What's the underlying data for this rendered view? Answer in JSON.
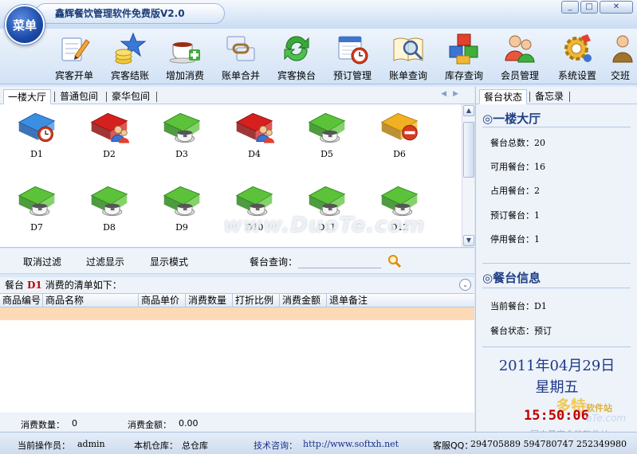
{
  "window": {
    "menu_label": "菜单",
    "title": "鑫辉餐饮管理软件免费版V2.0",
    "minimize": "_",
    "maximize": "□",
    "close": "✕"
  },
  "toolbar": {
    "items": [
      {
        "label": "宾客开单",
        "icon": "pencil-note-icon"
      },
      {
        "label": "宾客结账",
        "icon": "coins-star-icon"
      },
      {
        "label": "增加消费",
        "icon": "teacup-plus-icon"
      },
      {
        "label": "账单合并",
        "icon": "chain-link-icon"
      },
      {
        "label": "宾客换台",
        "icon": "green-swap-icon"
      },
      {
        "label": "预订管理",
        "icon": "calendar-clock-icon"
      },
      {
        "label": "账单查询",
        "icon": "magnifier-book-icon"
      },
      {
        "label": "库存查询",
        "icon": "cubes-icon"
      },
      {
        "label": "会员管理",
        "icon": "members-icon"
      },
      {
        "label": "系统设置",
        "icon": "gear-icon"
      },
      {
        "label": "交班",
        "icon": "handover-icon"
      }
    ]
  },
  "area_tabs": {
    "items": [
      "一楼大厅",
      "普通包间",
      "豪华包间"
    ],
    "active": "一楼大厅"
  },
  "tables": [
    {
      "id": "D1",
      "state": "reserved"
    },
    {
      "id": "D2",
      "state": "occupied"
    },
    {
      "id": "D3",
      "state": "available"
    },
    {
      "id": "D4",
      "state": "occupied"
    },
    {
      "id": "D5",
      "state": "available"
    },
    {
      "id": "D6",
      "state": "disabled"
    },
    {
      "id": "D7",
      "state": "available"
    },
    {
      "id": "D8",
      "state": "available"
    },
    {
      "id": "D9",
      "state": "available"
    },
    {
      "id": "D10",
      "state": "available"
    },
    {
      "id": "D11",
      "state": "available"
    },
    {
      "id": "D12",
      "state": "available"
    }
  ],
  "filter": {
    "cancel_filter": "取消过滤",
    "filter_display": "过滤显示",
    "display_mode": "显示模式",
    "search_label": "餐台查询：",
    "search_value": ""
  },
  "orders": {
    "prefix": "餐台",
    "table_no": "D1",
    "suffix": "消费的清单如下：",
    "columns": [
      "商品编号",
      "商品名称",
      "商品单价",
      "消费数量",
      "打折比例",
      "消费金额",
      "退单备注"
    ]
  },
  "totals": {
    "qty_label": "消费数量：",
    "qty_value": "0",
    "amount_label": "消费金额：",
    "amount_value": "0.00"
  },
  "right_panel": {
    "tabs": [
      "餐台状态",
      "备忘录"
    ],
    "hall_title": "◎一楼大厅",
    "stats": [
      {
        "label": "餐台总数：",
        "value": "20"
      },
      {
        "label": "可用餐台：",
        "value": "16"
      },
      {
        "label": "占用餐台：",
        "value": "2"
      },
      {
        "label": "预订餐台：",
        "value": "1"
      },
      {
        "label": "停用餐台：",
        "value": "1"
      }
    ],
    "info_title": "◎餐台信息",
    "current_label": "当前餐台：",
    "current_value": "D1",
    "status_label": "餐台状态：",
    "status_value": "预订",
    "date": "2011年04月29日",
    "weekday": "星期五",
    "time": "15:50:06",
    "watermark_logo": "多特",
    "watermark_logo_small": "软件站",
    "watermark_sub": "oTe.com",
    "watermark_bottom": "国内最安全的软件站"
  },
  "watermark_center": "www.DuoTe.com",
  "status": {
    "operator_label": "当前操作员：",
    "operator": "admin",
    "warehouse_label": "本机仓库：",
    "warehouse": "总仓库",
    "support_label": "技术咨询：",
    "support_url": "http://www.softxh.net",
    "qq_label": "客服QQ：",
    "qq_numbers": "294705889   594780747 252349980"
  },
  "colors": {
    "accent": "#1d3888",
    "occupied": "#d62020",
    "available": "#5cc23a",
    "reserved": "#3b8fe0",
    "disabled": "#f0b020",
    "selected_row": "#fdd9b5",
    "clock": "#c00000"
  }
}
